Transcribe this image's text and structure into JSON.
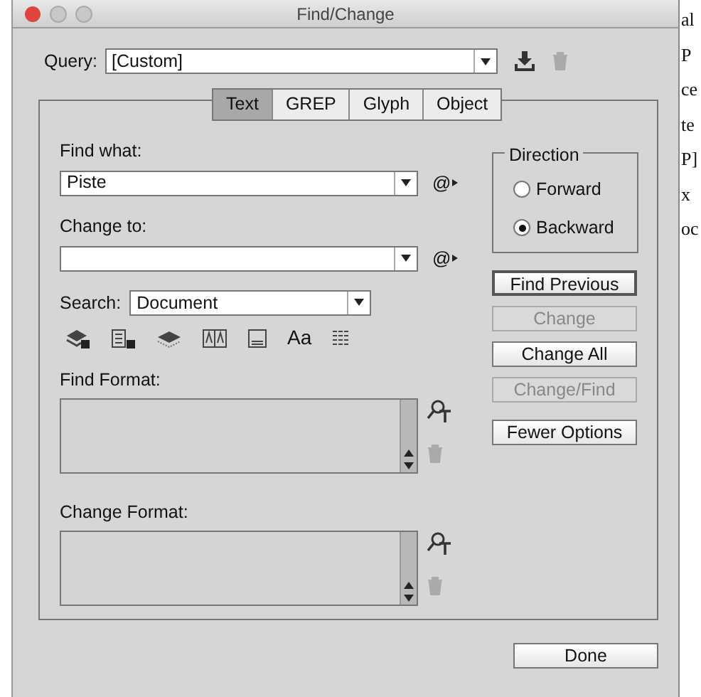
{
  "window": {
    "title": "Find/Change"
  },
  "query": {
    "label": "Query:",
    "value": "[Custom]"
  },
  "tabs": [
    {
      "label": "Text",
      "selected": true
    },
    {
      "label": "GREP",
      "selected": false
    },
    {
      "label": "Glyph",
      "selected": false
    },
    {
      "label": "Object",
      "selected": false
    }
  ],
  "find_what": {
    "label": "Find what:",
    "value": "Piste",
    "special_characters": "@"
  },
  "change_to": {
    "label": "Change to:",
    "special_characters": "@"
  },
  "search": {
    "label": "Search:",
    "value": "Document"
  },
  "case_toggle": "Aa",
  "find_format": {
    "label": "Find Format:"
  },
  "change_format": {
    "label": "Change Format:"
  },
  "direction": {
    "label": "Direction",
    "options": [
      {
        "label": "Forward",
        "selected": false
      },
      {
        "label": "Backward",
        "selected": true
      }
    ]
  },
  "buttons": [
    {
      "label": "Find Previous",
      "disabled": false,
      "default": true
    },
    {
      "label": "Change",
      "disabled": true,
      "default": false
    },
    {
      "label": "Change All",
      "disabled": false,
      "default": false
    },
    {
      "label": "Change/Find",
      "disabled": true,
      "default": false
    },
    {
      "label": "Fewer Options",
      "disabled": false,
      "default": false
    }
  ],
  "done": {
    "label": "Done"
  },
  "document_text": [
    "al",
    "P",
    "ce",
    "te",
    "P]",
    "x",
    "oc"
  ]
}
